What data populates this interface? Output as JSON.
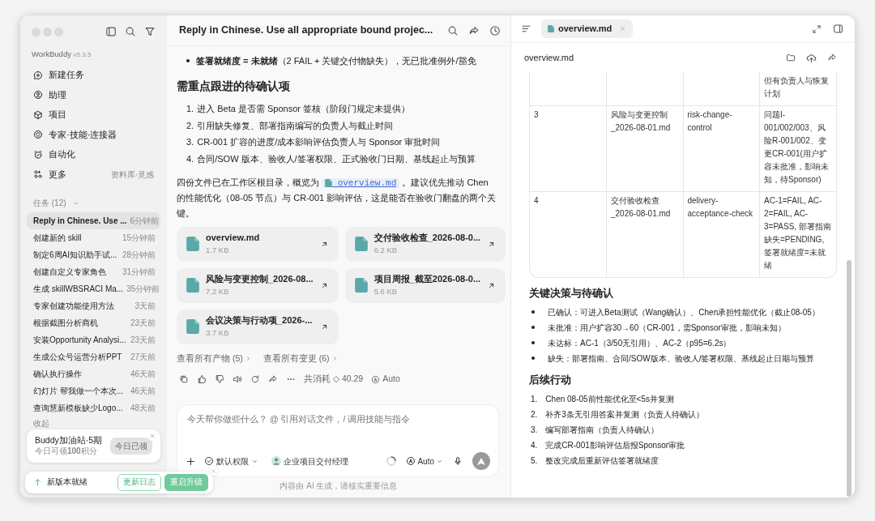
{
  "sidebar": {
    "app_name": "WorkBuddy",
    "version": "v5.3.5",
    "nav": [
      {
        "kind": "new",
        "label": "新建任务"
      },
      {
        "kind": "assistant",
        "label": "助理"
      },
      {
        "kind": "project",
        "label": "项目"
      },
      {
        "kind": "experts",
        "label": "专家·技能·连接器"
      },
      {
        "kind": "automation",
        "label": "自动化"
      },
      {
        "kind": "more",
        "label": "更多",
        "hint": "资料库·灵感"
      }
    ],
    "tasks_header": "任务 (12)",
    "tasks": [
      {
        "title": "Reply in Chinese. Use ...",
        "time": "6分钟前",
        "selected": true
      },
      {
        "title": "创建新的 skill",
        "time": "15分钟前",
        "selected": false
      },
      {
        "title": "制定6周AI知识助手试...",
        "time": "28分钟前",
        "selected": false
      },
      {
        "title": "创建自定义专家角色",
        "time": "31分钟前",
        "selected": false
      },
      {
        "title": "生成 skillWBSRACI Ma...",
        "time": "35分钟前",
        "selected": false
      },
      {
        "title": "专家创建功能使用方法",
        "time": "3天前",
        "selected": false
      },
      {
        "title": "根据截图分析商机",
        "time": "23天前",
        "selected": false
      },
      {
        "title": "安装Opportunity Analysi...",
        "time": "23天前",
        "selected": false
      },
      {
        "title": "生成公众号运营分析PPT",
        "time": "27天前",
        "selected": false
      },
      {
        "title": "确认执行操作",
        "time": "46天前",
        "selected": false
      },
      {
        "title": "幻灯片 帮我做一个本次...",
        "time": "46天前",
        "selected": false
      },
      {
        "title": "查询慧新模板缺少Logo...",
        "time": "48天前",
        "selected": false
      }
    ],
    "collapse": "收起",
    "promo": {
      "title": "Buddy加油站·5期",
      "text": "今日可领**100**积分",
      "button": "今日已领",
      "button_disabled": true
    }
  },
  "update_toast": {
    "text": "新版本就绪",
    "buttons": [
      "更新日志",
      "重启升级"
    ]
  },
  "chat": {
    "title": "Reply in Chinese. Use all appropriate bound projec...",
    "bullet": "**签署就绪度 = 未就绪**（2 FAIL + 关键交付物缺失），无已批准例外/豁免",
    "heading": "需重点跟进的待确认项",
    "follow_ups": [
      {
        "number": "1.",
        "text": "进入 Beta 是否需 Sponsor 签核（阶段门规定未提供）"
      },
      {
        "number": "2.",
        "text": "引用缺失修复、部署指南编写的负责人与截止时间"
      },
      {
        "number": "3.",
        "text": "CR-001 扩容的进度/成本影响评估负责人与 Sponsor 审批时间"
      },
      {
        "number": "4.",
        "text": "合同/SOW 版本、验收人/签署权限、正式验收门日期、基线起止与预算"
      }
    ],
    "summary": {
      "before": "四份文件已在工作区根目录，概览为",
      "link": "overview.md",
      "after": "。建议优先推动 Chen 的性能优化（08-05 节点）与 CR-001 影响评估，这是能否在验收门翻盘的两个关键。"
    },
    "files": [
      {
        "name": "overview.md",
        "size": "1.7 KB"
      },
      {
        "name": "交付验收检查_2026-08-0...",
        "size": "6.2 KB"
      },
      {
        "name": "风险与变更控制_2026-08...",
        "size": "7.2 KB"
      },
      {
        "name": "项目周报_截至2026-08-0...",
        "size": "5.6 KB"
      },
      {
        "name": "会议决策与行动项_2026-...",
        "size": "3.7 KB"
      }
    ],
    "links": [
      "查看所有产物 (5)",
      "查看所有变更 (6)"
    ],
    "usage": "共消耗 ◇ 40.29",
    "model": "Auto"
  },
  "composer": {
    "placeholder": "今天帮你做些什么？ @ 引用对话文件，/ 调用技能与指令",
    "permission": "默认权限",
    "agent": "企业项目交付经理",
    "model": "Auto"
  },
  "disclaimer": "内容由 AI 生成，请核实重要信息",
  "preview": {
    "tab": {
      "label": "overview.md",
      "selected": true
    },
    "title": "overview.md",
    "table": {
      "rows": [
        {
          "column_4": "但有负责人与恢复计划"
        },
        {
          "column_1": "3",
          "column_2": "风险与变更控制_2026-08-01.md",
          "column_3": "risk-change-control",
          "column_4": "问题I-001/002/003、风险R-001/002、变更CR-001(用户扩容未批准，影响未知，待Sponsor)"
        },
        {
          "column_1": "4",
          "column_2": "交付验收检查_2026-08-01.md",
          "column_3": "delivery-acceptance-check",
          "column_4": "AC-1=FAIL, AC-2=FAIL, AC-3=PASS, 部署指南缺失=PENDING, 签署就绪度=未就绪"
        }
      ]
    },
    "sections": [
      {
        "heading": "关键决策与待确认",
        "kind": "bullets",
        "items": [
          {
            "text": "已确认：可进入Beta测试（Wang确认）、Chen承担性能优化（截止08-05）"
          },
          {
            "text": "未批准：用户扩容30→60（CR-001，需Sponsor审批，影响未知）"
          },
          {
            "text": "未达标：AC-1（3/50无引用）、AC-2（p95=6.2s）"
          },
          {
            "text": "缺失：部署指南、合同/SOW版本、验收人/签署权限、基线起止日期与预算"
          }
        ]
      },
      {
        "heading": "后续行动",
        "kind": "numbered",
        "items": [
          {
            "number": "1.",
            "text": "Chen 08-05前性能优化至<5s并复测"
          },
          {
            "number": "2.",
            "text": "补齐3条无引用答案并复测（负责人待确认）"
          },
          {
            "number": "3.",
            "text": "编写部署指南（负责人待确认）"
          },
          {
            "number": "4.",
            "text": "完成CR-001影响评估后报Sponsor审批"
          },
          {
            "number": "5.",
            "text": "整改完成后重新评估签署就绪度"
          }
        ]
      }
    ]
  }
}
